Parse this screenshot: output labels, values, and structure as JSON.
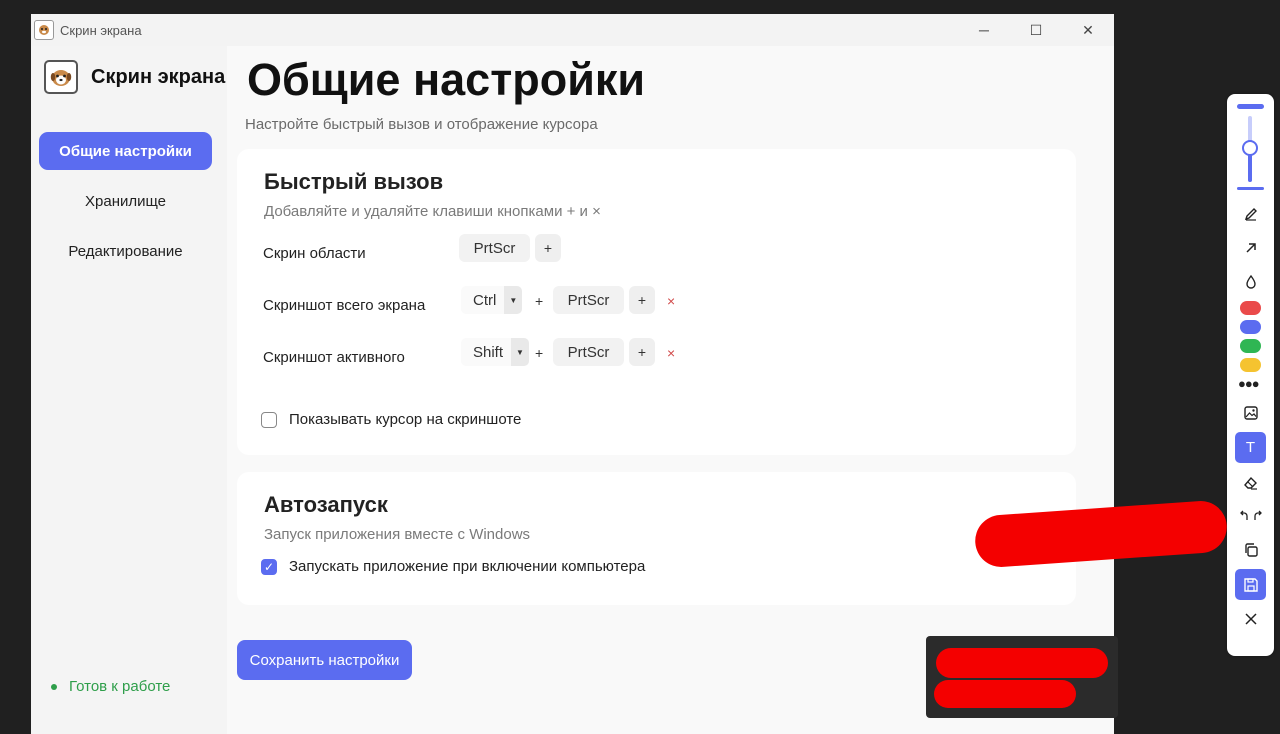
{
  "window": {
    "title": "Скрин экрана",
    "controls": {
      "minimize": "─",
      "maximize": "☐",
      "close": "✕"
    }
  },
  "sidebar": {
    "app_name": "Скрин экрана",
    "items": [
      {
        "label": "Общие настройки",
        "active": true
      },
      {
        "label": "Хранилище",
        "active": false
      },
      {
        "label": "Редактирование",
        "active": false
      }
    ],
    "status": "Готов к работе"
  },
  "main": {
    "title": "Общие настройки",
    "subtitle": "Настройте быстрый вызов и отображение курсора",
    "hotkeys": {
      "title": "Быстрый вызов",
      "description": "Добавляйте и удаляйте клавиши кнопками + и ×",
      "rows": [
        {
          "label": "Скрин области",
          "modifier": "",
          "key": "PrtScr"
        },
        {
          "label": "Скриншот всего экрана",
          "modifier": "Ctrl",
          "key": "PrtScr"
        },
        {
          "label": "Скриншот активного",
          "modifier": "Shift",
          "key": "PrtScr"
        }
      ],
      "plus": "+",
      "remove": "×",
      "show_cursor_label": "Показывать курсор на скриншоте",
      "show_cursor_checked": false
    },
    "autostart": {
      "title": "Автозапуск",
      "description": "Запуск приложения вместе с Windows",
      "checkbox_label": "Запускать приложение при включении компьютера",
      "checked": true
    },
    "save_label": "Сохранить настройки"
  },
  "toolbar": {
    "text_tool": "T",
    "colors": [
      "#ea4a4a",
      "#5b6cf0",
      "#2fb653",
      "#f5c330"
    ],
    "accent": "#5b6cf0",
    "size_level": 0.55
  },
  "colors": {
    "accent": "#5b6cf0",
    "status": "#2e9e4a",
    "remove": "#d14a4a",
    "redaction": "#f40000"
  }
}
